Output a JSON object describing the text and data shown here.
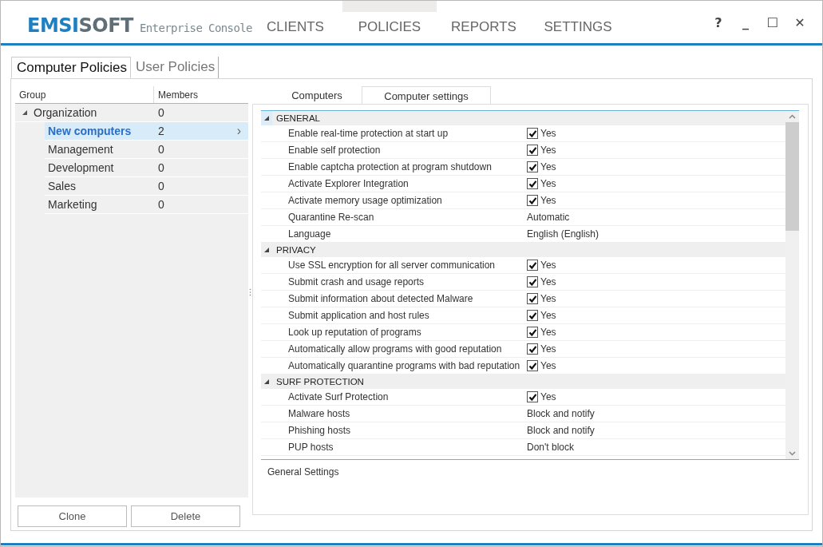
{
  "window": {
    "logo_primary": "EMSI",
    "logo_secondary": "SOFT",
    "product": "Enterprise Console",
    "controls": [
      "?",
      "_",
      "☐",
      "✕"
    ]
  },
  "nav": [
    {
      "label": "CLIENTS",
      "selected": false
    },
    {
      "label": "POLICIES",
      "selected": true
    },
    {
      "label": "REPORTS",
      "selected": false
    },
    {
      "label": "SETTINGS",
      "selected": false
    }
  ],
  "policy_tabs": [
    {
      "label": "Computer Policies",
      "selected": true
    },
    {
      "label": "User Policies",
      "selected": false
    }
  ],
  "groups": {
    "columns": [
      "Group",
      "Members"
    ],
    "tree": [
      {
        "name": "Organization",
        "members": "0",
        "expanded": true,
        "selected": false,
        "children": [
          {
            "name": "New computers",
            "members": "2",
            "selected": true,
            "arrow": "›"
          },
          {
            "name": "Management",
            "members": "0",
            "selected": false
          },
          {
            "name": "Development",
            "members": "0",
            "selected": false
          },
          {
            "name": "Sales",
            "members": "0",
            "selected": false
          },
          {
            "name": "Marketing",
            "members": "0",
            "selected": false
          }
        ]
      }
    ]
  },
  "buttons": [
    "Clone",
    "Delete"
  ],
  "detail_tabs": [
    {
      "label": "Computers",
      "selected": false
    },
    {
      "label": "Computer settings",
      "selected": true
    }
  ],
  "sections": [
    {
      "title": "GENERAL",
      "expanded": true,
      "selected": true,
      "rows": [
        {
          "kind": "check",
          "label": "Enable real-time protection at start up",
          "checked": true,
          "value": "Yes"
        },
        {
          "kind": "check",
          "label": "Enable self protection",
          "checked": true,
          "value": "Yes"
        },
        {
          "kind": "check",
          "label": "Enable captcha protection at program shutdown",
          "checked": true,
          "value": "Yes"
        },
        {
          "kind": "check",
          "label": "Activate Explorer Integration",
          "checked": true,
          "value": "Yes"
        },
        {
          "kind": "check",
          "label": "Activate memory usage optimization",
          "checked": true,
          "value": "Yes"
        },
        {
          "kind": "text",
          "label": "Quarantine Re-scan",
          "value": "Automatic"
        },
        {
          "kind": "text",
          "label": "Language",
          "value": "English (English)"
        }
      ]
    },
    {
      "title": "PRIVACY",
      "expanded": true,
      "selected": false,
      "rows": [
        {
          "kind": "check",
          "label": "Use SSL encryption for all server communication",
          "checked": true,
          "value": "Yes"
        },
        {
          "kind": "check",
          "label": "Submit crash and usage reports",
          "checked": true,
          "value": "Yes"
        },
        {
          "kind": "check",
          "label": "Submit information about detected Malware",
          "checked": true,
          "value": "Yes"
        },
        {
          "kind": "check",
          "label": "Submit application and host rules",
          "checked": true,
          "value": "Yes"
        },
        {
          "kind": "check",
          "label": "Look up reputation of programs",
          "checked": true,
          "value": "Yes"
        },
        {
          "kind": "check",
          "label": "Automatically allow programs with good reputation",
          "checked": true,
          "value": "Yes"
        },
        {
          "kind": "check",
          "label": "Automatically quarantine programs with bad reputation",
          "checked": true,
          "value": "Yes"
        }
      ]
    },
    {
      "title": "SURF PROTECTION",
      "expanded": true,
      "selected": false,
      "rows": [
        {
          "kind": "check",
          "label": "Activate Surf Protection",
          "checked": true,
          "value": "Yes"
        },
        {
          "kind": "text",
          "label": "Malware hosts",
          "value": "Block and notify"
        },
        {
          "kind": "text",
          "label": "Phishing hosts",
          "value": "Block and notify"
        },
        {
          "kind": "text",
          "label": "PUP hosts",
          "value": "Don't block"
        }
      ]
    }
  ],
  "description": "General Settings"
}
